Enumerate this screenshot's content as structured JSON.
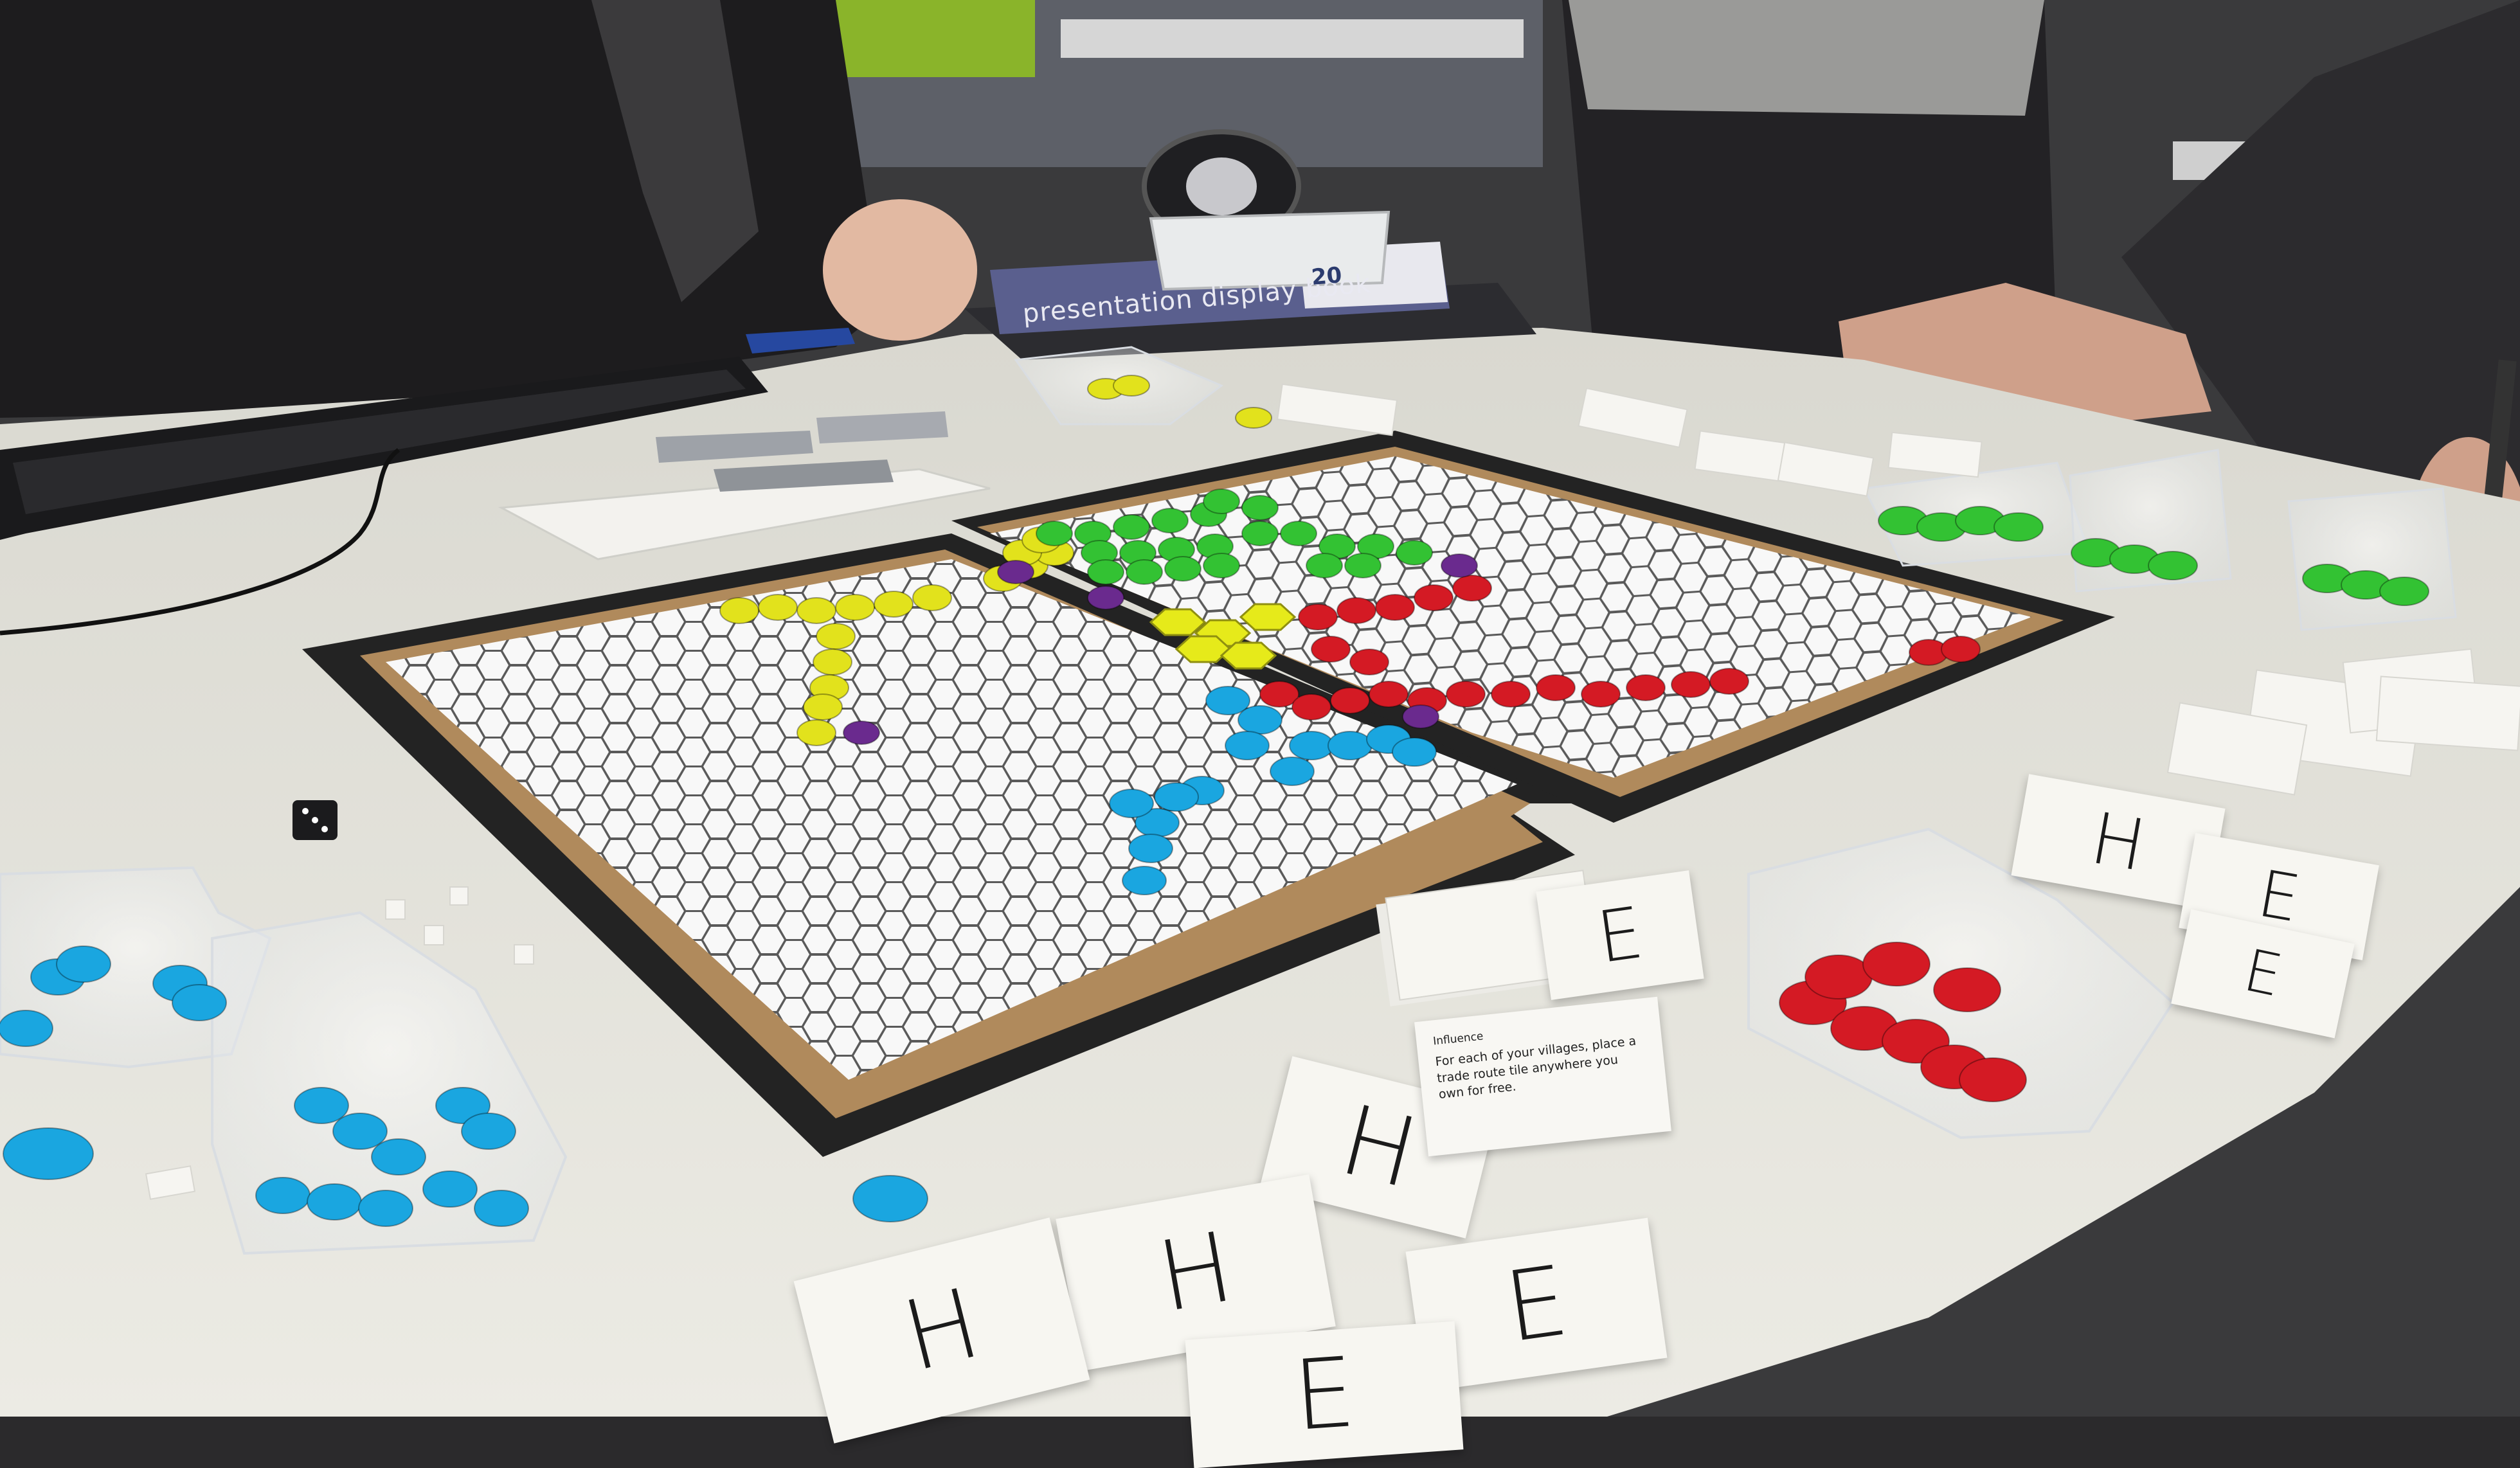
{
  "book": {
    "title": "presentation display book",
    "number": "20"
  },
  "influence_card": {
    "title": "Influence",
    "text": "For each of your villages, place a trade route tile anywhere you own for free."
  },
  "letter_cards": [
    {
      "id": "h1",
      "letter": "H"
    },
    {
      "id": "h2",
      "letter": "H"
    },
    {
      "id": "h3",
      "letter": "H"
    },
    {
      "id": "e1",
      "letter": "E"
    },
    {
      "id": "e2",
      "letter": "E"
    },
    {
      "id": "e3",
      "letter": "E"
    },
    {
      "id": "h4",
      "letter": "H"
    },
    {
      "id": "e4",
      "letter": "E"
    },
    {
      "id": "e5",
      "letter": "E"
    }
  ],
  "token_colors": {
    "yellow": "#e2e21c",
    "green": "#33c233",
    "red": "#d41a24",
    "blue": "#1aa6e0",
    "purple": "#6a2a8e"
  },
  "board_colors": {
    "frame": "#232323",
    "cardboard": "#b08a5c",
    "hex": "#f8f8f8",
    "hex_edge": "#555555"
  }
}
